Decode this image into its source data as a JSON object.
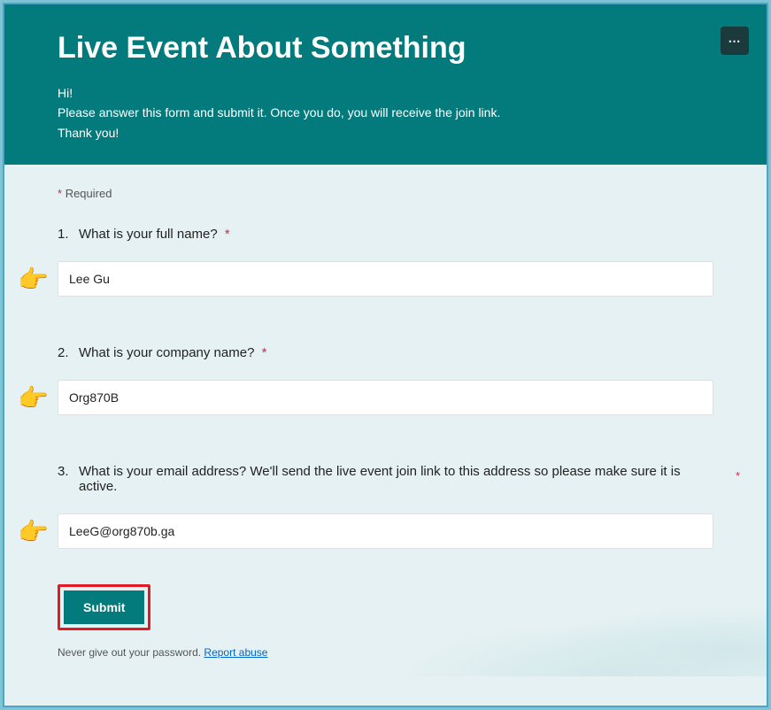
{
  "header": {
    "title": "Live Event About Something",
    "description_line1": "Hi!",
    "description_line2": "Please answer this form and submit it. Once you do, you will receive the join link.",
    "description_line3": "Thank you!",
    "more_icon": "⋯"
  },
  "required_label": "Required",
  "questions": [
    {
      "num": "1.",
      "text": "What is your full name?",
      "required": true,
      "value": "Lee Gu",
      "asterisk_inline": true
    },
    {
      "num": "2.",
      "text": "What is your company name?",
      "required": true,
      "value": "Org870B",
      "asterisk_inline": true
    },
    {
      "num": "3.",
      "text": "What is your email address? We'll send the live event join link to this address so please make sure it is active.",
      "required": true,
      "value": "LeeG@org870b.ga",
      "asterisk_inline": false
    }
  ],
  "submit_label": "Submit",
  "footer": {
    "password_note": "Never give out your password.",
    "report_link": "Report abuse"
  }
}
